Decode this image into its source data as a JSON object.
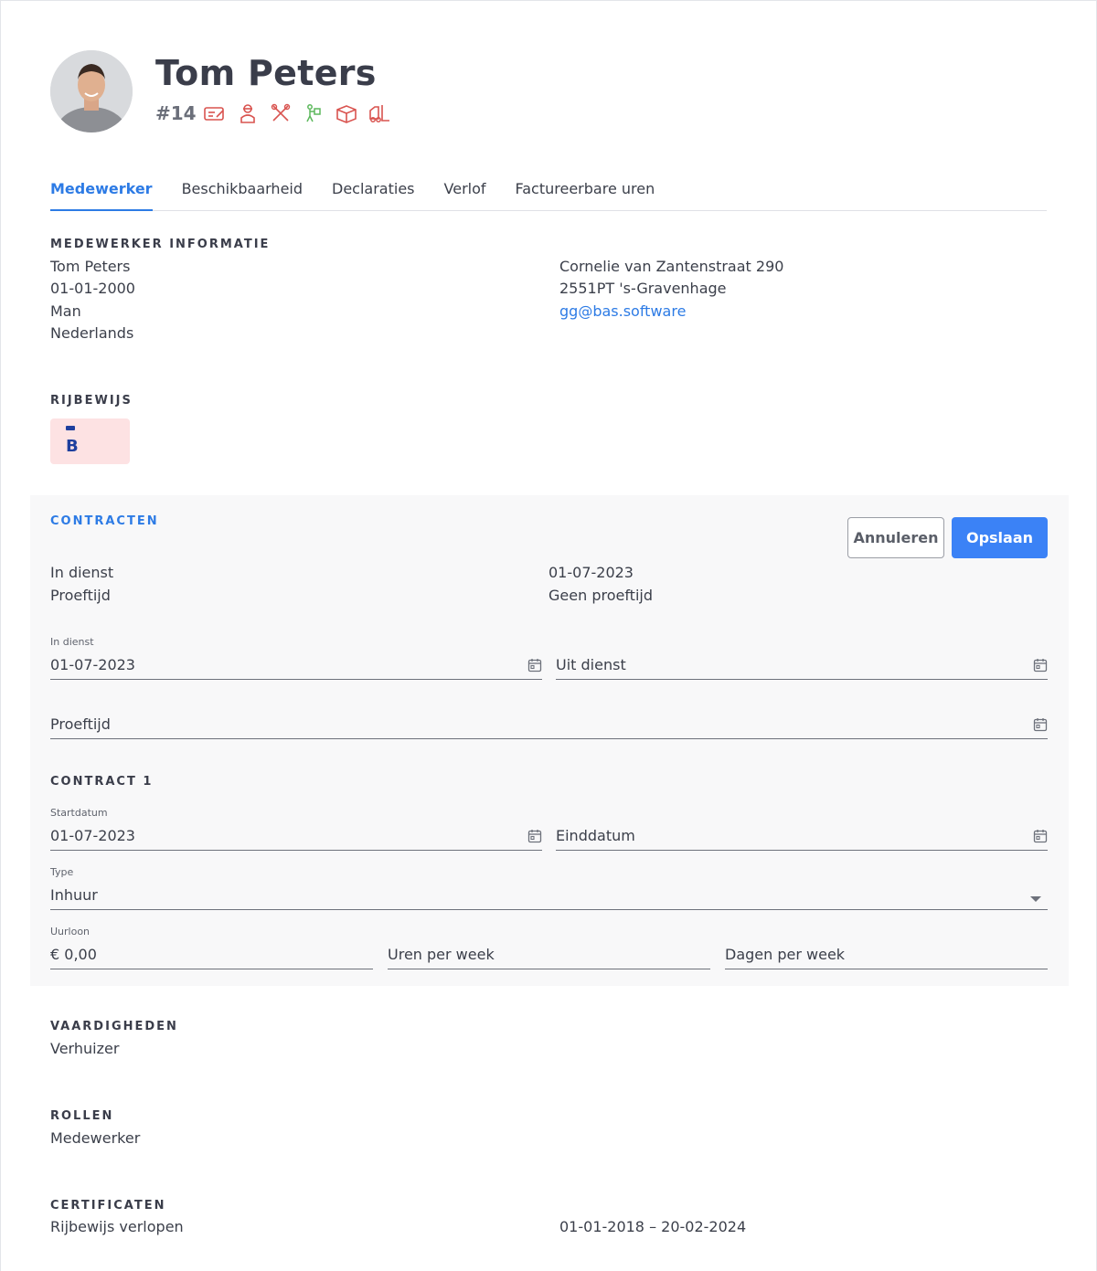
{
  "profile": {
    "name": "Tom Peters",
    "employee_number": "#14",
    "skill_icons": [
      "id-card-icon",
      "worker-icon",
      "tools-icon",
      "mover-icon",
      "box-icon",
      "forklift-icon"
    ]
  },
  "tabs": [
    {
      "label": "Medewerker",
      "active": true
    },
    {
      "label": "Beschikbaarheid",
      "active": false
    },
    {
      "label": "Declaraties",
      "active": false
    },
    {
      "label": "Verlof",
      "active": false
    },
    {
      "label": "Factureerbare uren",
      "active": false
    }
  ],
  "employee_info": {
    "heading": "MEDEWERKER INFORMATIE",
    "name": "Tom Peters",
    "birthdate": "01-01-2000",
    "gender": "Man",
    "nationality": "Nederlands",
    "street": "Cornelie van Zantenstraat 290",
    "city": "2551PT 's-Gravenhage",
    "email": "gg@bas.software"
  },
  "license": {
    "heading": "RIJBEWIJS",
    "category": "B"
  },
  "contracts": {
    "heading": "CONTRACTEN",
    "cancel_label": "Annuleren",
    "save_label": "Opslaan",
    "summary": {
      "in_service_label": "In dienst",
      "in_service_value": "01-07-2023",
      "probation_label": "Proeftijd",
      "probation_value": "Geen proeftijd"
    },
    "fields": {
      "in_service_label": "In dienst",
      "in_service_value": "01-07-2023",
      "out_service_placeholder": "Uit dienst",
      "probation_placeholder": "Proeftijd"
    },
    "contract1": {
      "heading": "CONTRACT 1",
      "start_label": "Startdatum",
      "start_value": "01-07-2023",
      "end_placeholder": "Einddatum",
      "type_label": "Type",
      "type_value": "Inhuur",
      "wage_label": "Uurloon",
      "wage_value": "€ 0,00",
      "hours_placeholder": "Uren per week",
      "days_placeholder": "Dagen per week"
    }
  },
  "skills": {
    "heading": "VAARDIGHEDEN",
    "value": "Verhuizer"
  },
  "roles": {
    "heading": "ROLLEN",
    "value": "Medewerker"
  },
  "certificates": {
    "heading": "CERTIFICATEN",
    "name": "Rijbewijs verlopen",
    "period": "01-01-2018 – 20-02-2024"
  },
  "colors": {
    "accent": "#2d7be5",
    "button_primary": "#3b82f6",
    "icon_red": "#d9534f",
    "icon_green": "#5cb85c",
    "license_bg": "#fde2e3"
  }
}
